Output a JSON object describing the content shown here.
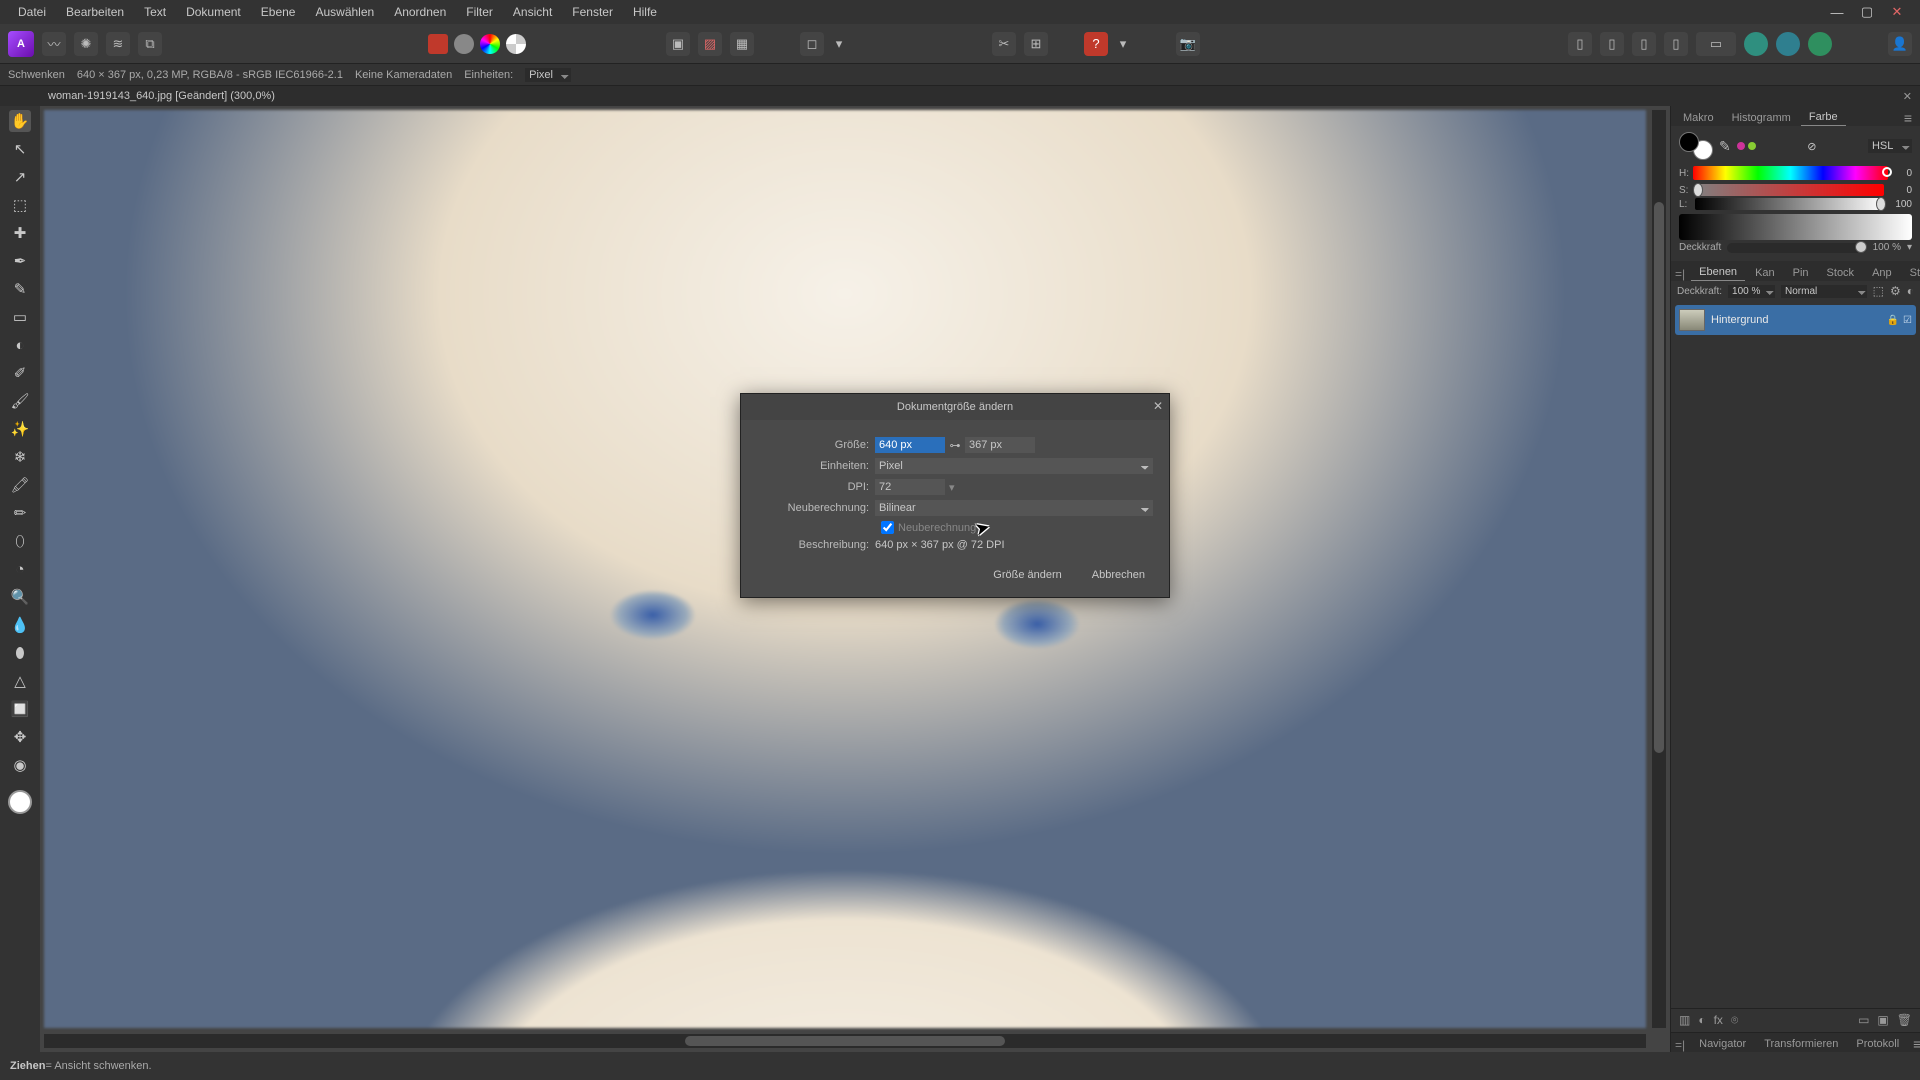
{
  "menubar": [
    "Datei",
    "Bearbeiten",
    "Text",
    "Dokument",
    "Ebene",
    "Auswählen",
    "Anordnen",
    "Filter",
    "Ansicht",
    "Fenster",
    "Hilfe"
  ],
  "context_bar": {
    "tool_name": "Schwenken",
    "doc_info": "640 × 367 px, 0,23 MP, RGBA/8 - sRGB IEC61966-2.1",
    "camera": "Keine Kameradaten",
    "units_label": "Einheiten:",
    "units_value": "Pixel"
  },
  "doc_tab": {
    "title": "woman-1919143_640.jpg [Geändert] (300,0%)"
  },
  "tools": [
    "✋",
    "↖",
    "↗",
    "⬚",
    "✚",
    "✒",
    "✎",
    "▭",
    "◐",
    "✐",
    "🖌",
    "✨",
    "❄",
    "🖍",
    "✏",
    "⬯",
    "◔",
    "🔍",
    "💧",
    "⬮",
    "△",
    "🔲",
    "✥",
    "◉"
  ],
  "right": {
    "color_tabs_left": [
      "Makro",
      "Histogramm",
      "Farbe"
    ],
    "color_active": "Farbe",
    "color_model": "HSL",
    "hsl": {
      "H": 0,
      "S": 0,
      "L": 100
    },
    "opacity_label": "Deckkraft",
    "opacity_value": "100 %",
    "layer_tabs": [
      "Ebenen",
      "Kan",
      "Pin",
      "Stock",
      "Anp",
      "Stile"
    ],
    "layer_active": "Ebenen",
    "layer_opacity_label": "Deckkraft:",
    "layer_opacity": "100 %",
    "blend_mode": "Normal",
    "layers": [
      {
        "name": "Hintergrund"
      }
    ],
    "bottom_tabs": [
      "Navigator",
      "Transformieren",
      "Protokoll"
    ]
  },
  "dialog": {
    "title": "Dokumentgröße ändern",
    "size_label": "Größe:",
    "width": "640 px",
    "height": "367 px",
    "units_label": "Einheiten:",
    "units_value": "Pixel",
    "dpi_label": "DPI:",
    "dpi_value": "72",
    "resample_label": "Neuberechnung:",
    "resample_value": "Bilinear",
    "resample_check": "Neuberechnung",
    "desc_label": "Beschreibung:",
    "desc_value": "640 px × 367 px @ 72 DPI",
    "ok": "Größe ändern",
    "cancel": "Abbrechen"
  },
  "status": {
    "bold": "Ziehen",
    "rest": " = Ansicht schwenken."
  }
}
